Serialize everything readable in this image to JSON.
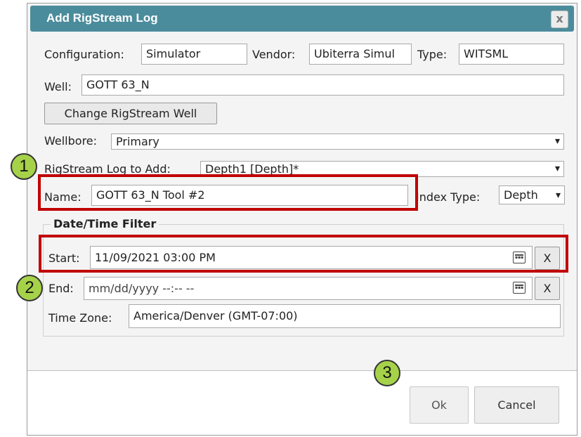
{
  "dialog": {
    "title": "Add RigStream Log",
    "close_label": "x"
  },
  "config": {
    "label": "Configuration:",
    "value": "Simulator"
  },
  "vendor": {
    "label": "Vendor:",
    "value": "Ubiterra Simul"
  },
  "type": {
    "label": "Type:",
    "value": "WITSML"
  },
  "well": {
    "label": "Well:",
    "value": "GOTT 63_N"
  },
  "change_well_label": "Change RigStream Well",
  "wellbore": {
    "label": "Wellbore:",
    "value": "Primary"
  },
  "log_to_add": {
    "label": "RigStream Log to Add:",
    "value": "Depth1 [Depth]*"
  },
  "name": {
    "label": "Name:",
    "value": "GOTT 63_N Tool #2"
  },
  "index_type": {
    "label": "Index Type:",
    "value": "Depth"
  },
  "filter": {
    "legend": "Date/Time Filter",
    "start_label": "Start:",
    "start_value": "11/09/2021 03:00  PM",
    "end_label": "End:",
    "end_placeholder": "mm/dd/yyyy --:-- --",
    "clear_label": "X",
    "tz_label": "Time Zone:",
    "tz_value": "America/Denver (GMT-07:00)"
  },
  "buttons": {
    "ok": "Ok",
    "cancel": "Cancel"
  },
  "callouts": [
    "1",
    "2",
    "3"
  ],
  "colors": {
    "titlebar": "#4b8c9c",
    "highlight": "#c00000",
    "badge": "#a6d24a"
  }
}
